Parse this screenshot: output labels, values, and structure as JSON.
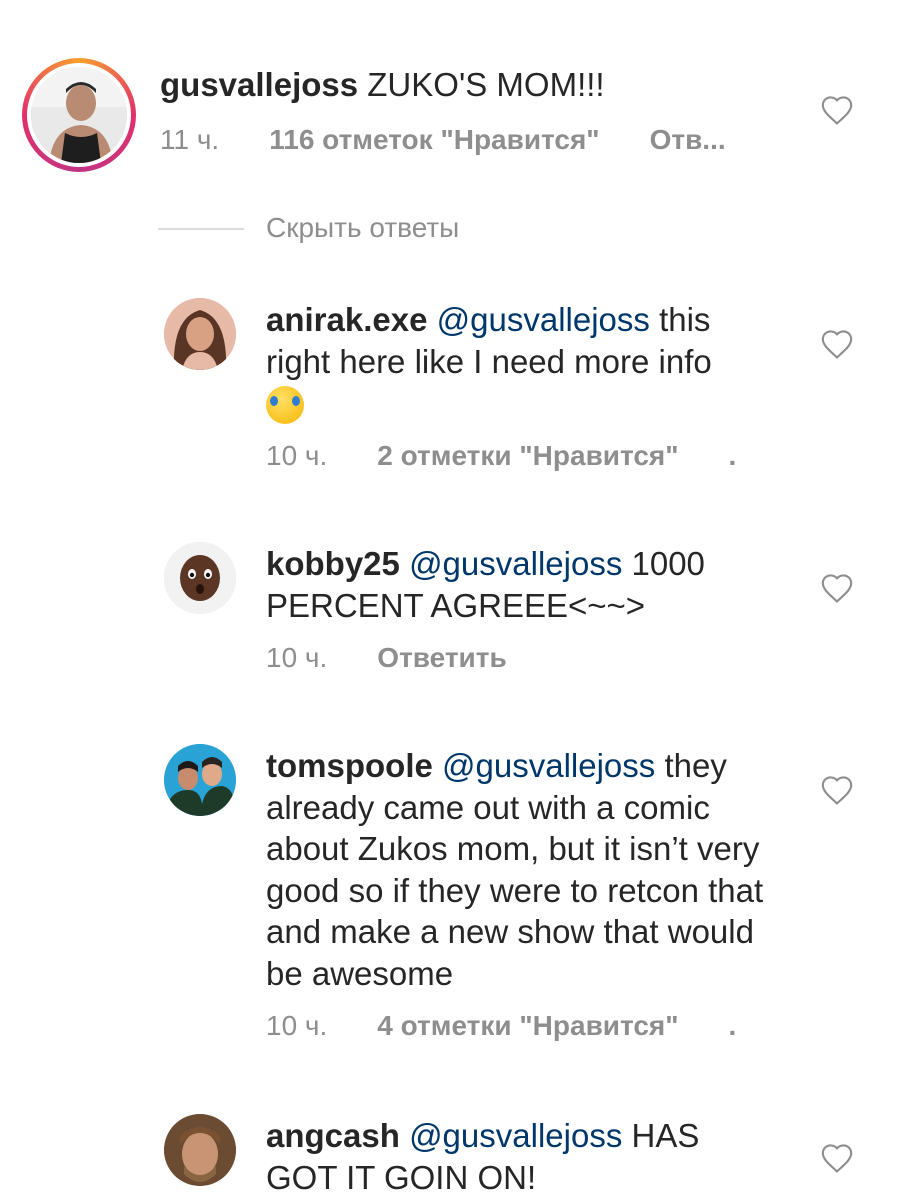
{
  "colors": {
    "text": "#262626",
    "secondary": "#8e8e8e",
    "mention": "#00376b",
    "divider": "#dbdbdb"
  },
  "main_comment": {
    "username": "gusvallejoss",
    "text": " ZUKO'S MOM!!!",
    "time": "11 ч.",
    "likes": "116 отметок \"Нравится\"",
    "reply": "Отв..."
  },
  "hide_replies": "Скрыть ответы",
  "replies": [
    {
      "username": "anirak.exe",
      "mention": "@gusvallejoss",
      "text": " this right here like I need more info",
      "emoji": "rolling-on-floor-laughing-emoji",
      "time": "10 ч.",
      "likes": "2 отметки \"Нравится\"",
      "reply": "."
    },
    {
      "username": "kobby25",
      "mention": "@gusvallejoss",
      "text": " 1000 PERCENT AGREEE<~~>",
      "time": "10 ч.",
      "reply": "Ответить"
    },
    {
      "username": "tomspoole",
      "mention": "@gusvallejoss",
      "text": " they already came out with a comic about Zukos mom, but it isn’t very good so if they were to retcon that and make a new show that would be awesome",
      "time": "10 ч.",
      "likes": "4 отметки \"Нравится\"",
      "reply": "."
    },
    {
      "username": "angcash",
      "mention": "@gusvallejoss",
      "text": " HAS GOT IT GOIN ON!"
    }
  ]
}
